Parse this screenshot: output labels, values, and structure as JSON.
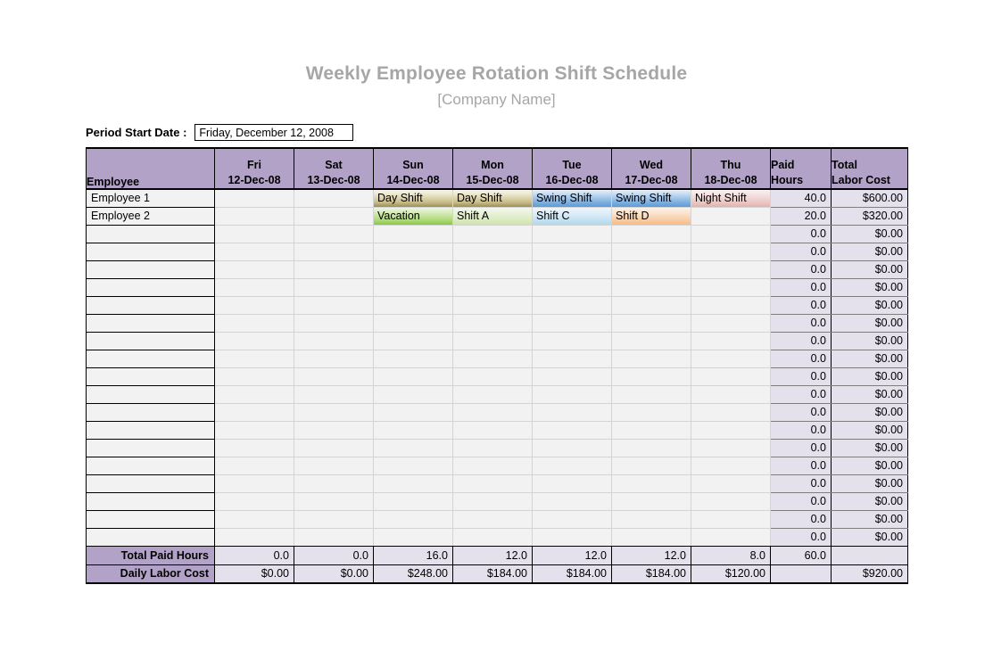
{
  "document": {
    "title": "Weekly Employee Rotation Shift Schedule",
    "subtitle": "[Company Name]"
  },
  "period": {
    "label": "Period Start Date :",
    "value": "Friday, December 12, 2008",
    "placeholder": "Friday, December 12, 2008"
  },
  "table": {
    "header": {
      "employee": "Employee",
      "days": [
        {
          "weekday": "Fri",
          "date": "12-Dec-08"
        },
        {
          "weekday": "Sat",
          "date": "13-Dec-08"
        },
        {
          "weekday": "Sun",
          "date": "14-Dec-08"
        },
        {
          "weekday": "Mon",
          "date": "15-Dec-08"
        },
        {
          "weekday": "Tue",
          "date": "16-Dec-08"
        },
        {
          "weekday": "Wed",
          "date": "17-Dec-08"
        },
        {
          "weekday": "Thu",
          "date": "18-Dec-08"
        }
      ],
      "paid_hours_l1": "Paid",
      "paid_hours_l2": "Hours",
      "total_cost_l1": "Total",
      "total_cost_l2": "Labor Cost"
    },
    "rows": [
      {
        "employee": "Employee 1",
        "shifts": [
          {
            "text": "",
            "fill": "none"
          },
          {
            "text": "",
            "fill": "none"
          },
          {
            "text": "Day Shift",
            "fill": "day"
          },
          {
            "text": "Day Shift",
            "fill": "day"
          },
          {
            "text": "Swing Shift",
            "fill": "swing"
          },
          {
            "text": "Swing Shift",
            "fill": "swing"
          },
          {
            "text": "Night Shift",
            "fill": "night"
          }
        ],
        "paid_hours": "40.0",
        "total_cost": "$600.00"
      },
      {
        "employee": "Employee 2",
        "shifts": [
          {
            "text": "",
            "fill": "none"
          },
          {
            "text": "",
            "fill": "none"
          },
          {
            "text": "Vacation",
            "fill": "vacation"
          },
          {
            "text": "Shift A",
            "fill": "shifta"
          },
          {
            "text": "Shift C",
            "fill": "shiftc"
          },
          {
            "text": "Shift  D",
            "fill": "shiftd"
          },
          {
            "text": "",
            "fill": "none"
          }
        ],
        "paid_hours": "20.0",
        "total_cost": "$320.00"
      },
      {
        "employee": "",
        "shifts": [],
        "paid_hours": "0.0",
        "total_cost": "$0.00"
      },
      {
        "employee": "",
        "shifts": [],
        "paid_hours": "0.0",
        "total_cost": "$0.00"
      },
      {
        "employee": "",
        "shifts": [],
        "paid_hours": "0.0",
        "total_cost": "$0.00"
      },
      {
        "employee": "",
        "shifts": [],
        "paid_hours": "0.0",
        "total_cost": "$0.00"
      },
      {
        "employee": "",
        "shifts": [],
        "paid_hours": "0.0",
        "total_cost": "$0.00"
      },
      {
        "employee": "",
        "shifts": [],
        "paid_hours": "0.0",
        "total_cost": "$0.00"
      },
      {
        "employee": "",
        "shifts": [],
        "paid_hours": "0.0",
        "total_cost": "$0.00"
      },
      {
        "employee": "",
        "shifts": [],
        "paid_hours": "0.0",
        "total_cost": "$0.00"
      },
      {
        "employee": "",
        "shifts": [],
        "paid_hours": "0.0",
        "total_cost": "$0.00"
      },
      {
        "employee": "",
        "shifts": [],
        "paid_hours": "0.0",
        "total_cost": "$0.00"
      },
      {
        "employee": "",
        "shifts": [],
        "paid_hours": "0.0",
        "total_cost": "$0.00"
      },
      {
        "employee": "",
        "shifts": [],
        "paid_hours": "0.0",
        "total_cost": "$0.00"
      },
      {
        "employee": "",
        "shifts": [],
        "paid_hours": "0.0",
        "total_cost": "$0.00"
      },
      {
        "employee": "",
        "shifts": [],
        "paid_hours": "0.0",
        "total_cost": "$0.00"
      },
      {
        "employee": "",
        "shifts": [],
        "paid_hours": "0.0",
        "total_cost": "$0.00"
      },
      {
        "employee": "",
        "shifts": [],
        "paid_hours": "0.0",
        "total_cost": "$0.00"
      },
      {
        "employee": "",
        "shifts": [],
        "paid_hours": "0.0",
        "total_cost": "$0.00"
      },
      {
        "employee": "",
        "shifts": [],
        "paid_hours": "0.0",
        "total_cost": "$0.00"
      }
    ],
    "totals": [
      {
        "label": "Total Paid Hours",
        "days": [
          "0.0",
          "0.0",
          "16.0",
          "12.0",
          "12.0",
          "12.0",
          "8.0"
        ],
        "paid_hours": "60.0",
        "total_cost": ""
      },
      {
        "label": "Daily Labor Cost",
        "days": [
          "$0.00",
          "$0.00",
          "$248.00",
          "$184.00",
          "$184.00",
          "$184.00",
          "$120.00"
        ],
        "paid_hours": "",
        "total_cost": "$920.00"
      }
    ]
  },
  "colors": {
    "header_purple": "#b3a2c8",
    "title_gray": "#a6a6a6",
    "cell_gray": "#f2f2f2",
    "num_lavender": "#e4e0ec",
    "day_shift": "#9c9058",
    "swing_shift": "#5e9bd4",
    "night_shift": "#dfb2ae",
    "vacation": "#8cc63f",
    "shift_a": "#cde3ac",
    "shift_c": "#b2d9ec",
    "shift_d": "#f7bb86"
  }
}
